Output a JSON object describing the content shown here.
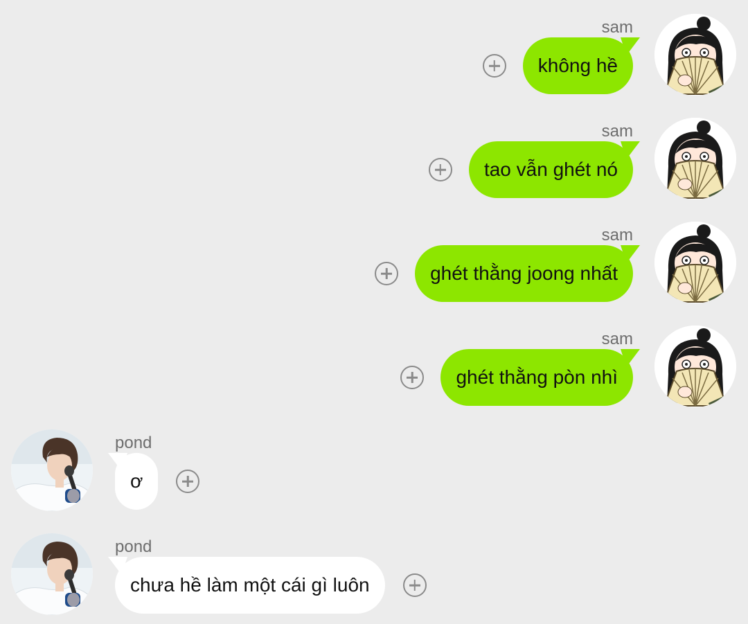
{
  "messages": [
    {
      "sender": "sam",
      "text": "không hề",
      "side": "right",
      "avatar_icon": "fan-girl-avatar-icon"
    },
    {
      "sender": "sam",
      "text": "tao vẫn ghét nó",
      "side": "right",
      "avatar_icon": "fan-girl-avatar-icon"
    },
    {
      "sender": "sam",
      "text": "ghét thằng joong nhất",
      "side": "right",
      "avatar_icon": "fan-girl-avatar-icon"
    },
    {
      "sender": "sam",
      "text": "ghét thằng pòn nhì",
      "side": "right",
      "avatar_icon": "fan-girl-avatar-icon"
    },
    {
      "sender": "pond",
      "text": "ơ",
      "side": "left",
      "avatar_icon": "man-with-microphone-avatar-icon"
    },
    {
      "sender": "pond",
      "text": "chưa hề làm một cái gì luôn",
      "side": "left",
      "avatar_icon": "man-with-microphone-avatar-icon"
    }
  ],
  "colors": {
    "background": "#ececec",
    "outgoing_bubble": "#8de600",
    "incoming_bubble": "#ffffff",
    "sender_name": "#6d6d6d",
    "plus_icon": "#8a8a8a"
  },
  "react_icon": "plus-circle-icon"
}
